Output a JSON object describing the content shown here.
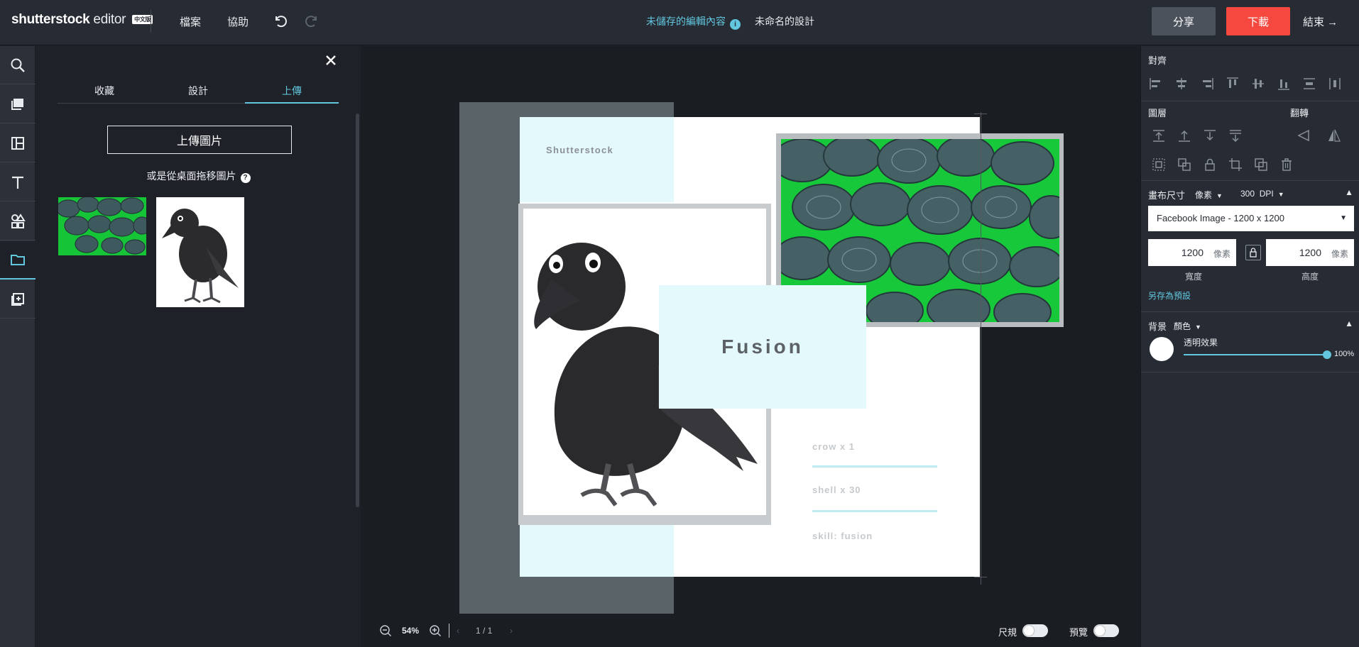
{
  "topbar": {
    "logo_brand": "shutterstock",
    "logo_editor": "editor",
    "logo_badge": "中文版",
    "menu_file": "檔案",
    "menu_help": "協助",
    "status_unsaved": "未儲存的編輯內容",
    "design_name": "未命名的設計",
    "share_label": "分享",
    "download_label": "下載",
    "finish_label": "結束 →"
  },
  "left_panel": {
    "tabs": [
      {
        "label": "收藏"
      },
      {
        "label": "設計"
      },
      {
        "label": "上傳"
      }
    ],
    "upload_button": "上傳圖片",
    "drag_hint": "或是從桌面拖移圖片"
  },
  "artboard": {
    "brand_text": "Shutterstock",
    "fusion_text": "Fusion",
    "stats": [
      {
        "label": "crow x 1"
      },
      {
        "label": "shell x 30"
      },
      {
        "label": "skill: fusion"
      }
    ],
    "colors": {
      "cyan": "#e4f9fc",
      "line": "#bdecf2",
      "side_panel": "#5a6468"
    }
  },
  "zoombar": {
    "zoom": "54%",
    "page_indicator": "1 / 1",
    "ruler_label": "尺規",
    "preview_label": "預覽"
  },
  "right_panel": {
    "align_title": "對齊",
    "layers_title": "圖層",
    "flip_title": "翻轉",
    "canvas_size_title": "畫布尺寸",
    "unit_select": "像素",
    "dpi_value": "300",
    "dpi_unit": "DPI",
    "preset": "Facebook Image - 1200 x 1200",
    "width_value": "1200",
    "height_value": "1200",
    "px_unit": "像素",
    "width_label": "寬度",
    "height_label": "高度",
    "save_preset": "另存為預設",
    "background_title": "背景",
    "bg_type": "顏色",
    "opacity_label": "透明效果",
    "opacity_value": "100%",
    "accent_color": "#61c6de",
    "download_color": "#f5483e"
  }
}
